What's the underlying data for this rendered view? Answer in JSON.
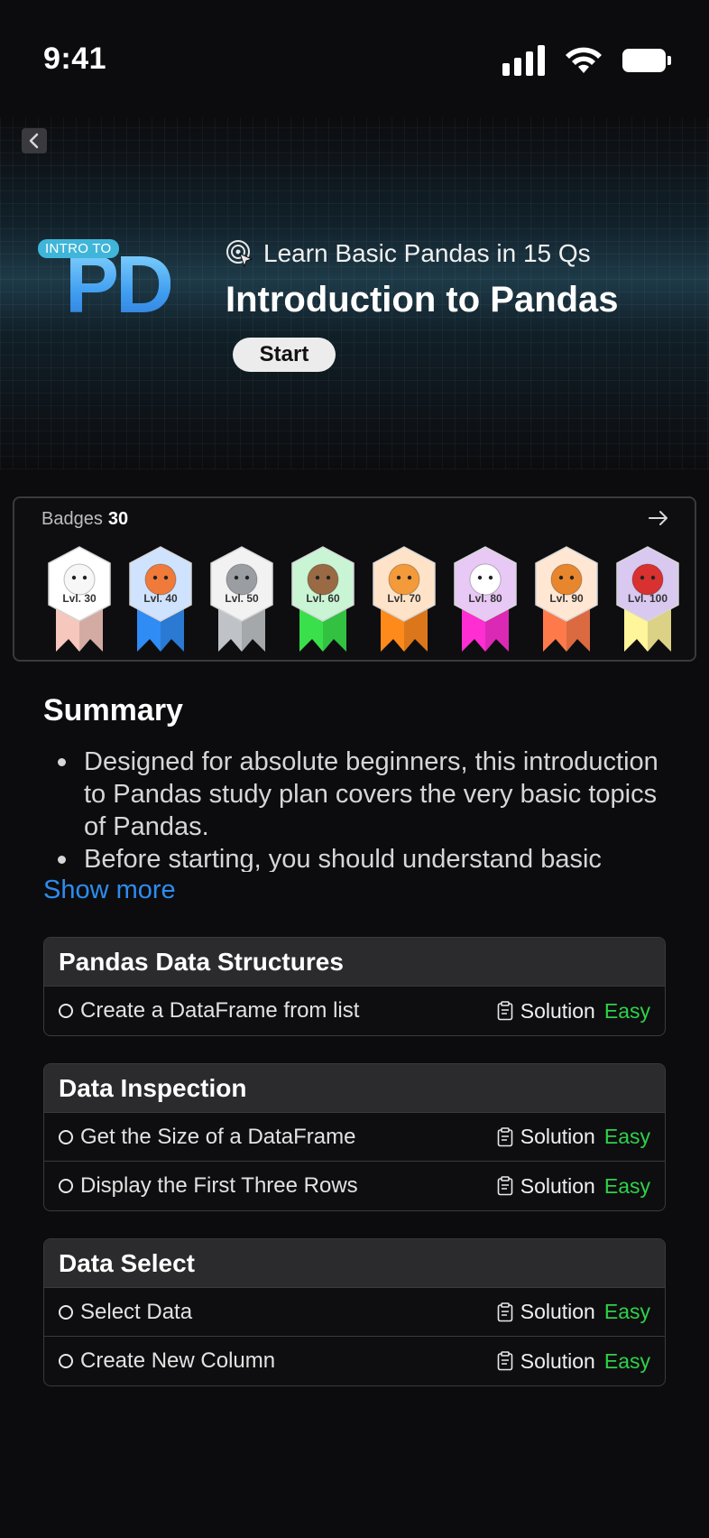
{
  "status_bar": {
    "time": "9:41"
  },
  "hero": {
    "logo_tag": "INTRO TO",
    "logo_letters": "PD",
    "subtitle": "Learn Basic Pandas in 15 Qs",
    "title": "Introduction to Pandas",
    "start_label": "Start"
  },
  "badges": {
    "label": "Badges",
    "count": "30",
    "items": [
      {
        "label": "Lvl. 30",
        "animal": "rabbit",
        "ribbon": "#f6c7bd",
        "frame": "#ffffff"
      },
      {
        "label": "Lvl. 40",
        "animal": "fox",
        "ribbon": "#2f8cf5",
        "frame": "#cfe3ff"
      },
      {
        "label": "Lvl. 50",
        "animal": "wolf",
        "ribbon": "#bfc3c7",
        "frame": "#f2f2f2"
      },
      {
        "label": "Lvl. 60",
        "animal": "bear",
        "ribbon": "#39e04b",
        "frame": "#c9f5d4"
      },
      {
        "label": "Lvl. 70",
        "animal": "tiger",
        "ribbon": "#ff8a1c",
        "frame": "#ffe3c8"
      },
      {
        "label": "Lvl. 80",
        "animal": "eagle",
        "ribbon": "#ff2ed2",
        "frame": "#e8c8f5"
      },
      {
        "label": "Lvl. 90",
        "animal": "lion",
        "ribbon": "#ff7a4a",
        "frame": "#ffe7d4"
      },
      {
        "label": "Lvl. 100",
        "animal": "dragon",
        "ribbon": "#fff59a",
        "frame": "#d9c8f0"
      }
    ]
  },
  "summary": {
    "title": "Summary",
    "items": [
      "Designed for absolute beginners, this introduction to Pandas study plan covers the very basic topics of Pandas.",
      "Before starting, you should understand basic"
    ],
    "show_more": "Show more"
  },
  "sections": [
    {
      "title": "Pandas Data Structures",
      "problems": [
        {
          "title": "Create a DataFrame from list",
          "solution": "Solution",
          "difficulty": "Easy"
        }
      ]
    },
    {
      "title": "Data Inspection",
      "problems": [
        {
          "title": "Get the Size of a DataFrame",
          "solution": "Solution",
          "difficulty": "Easy"
        },
        {
          "title": "Display the First Three Rows",
          "solution": "Solution",
          "difficulty": "Easy"
        }
      ]
    },
    {
      "title": "Data Select",
      "problems": [
        {
          "title": "Select Data",
          "solution": "Solution",
          "difficulty": "Easy"
        },
        {
          "title": "Create New Column",
          "solution": "Solution",
          "difficulty": "Easy"
        }
      ]
    }
  ]
}
